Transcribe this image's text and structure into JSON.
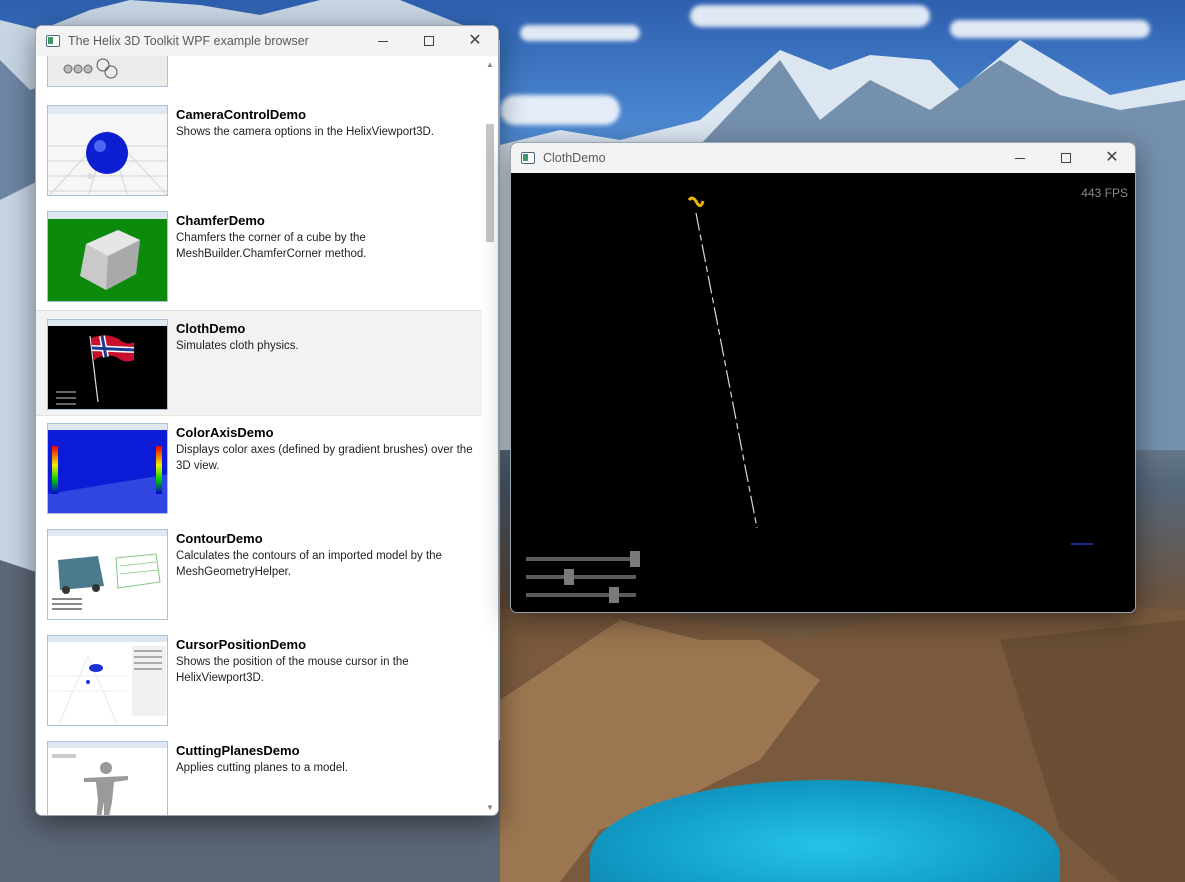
{
  "browser_window": {
    "title": "The Helix 3D Toolkit WPF example browser",
    "items": [
      {
        "name": "CameraControlDemo",
        "description": "Shows the camera options in the HelixViewport3D."
      },
      {
        "name": "ChamferDemo",
        "description": "Chamfers the corner of a cube by the MeshBuilder.ChamferCorner method."
      },
      {
        "name": "ClothDemo",
        "description": "Simulates cloth physics."
      },
      {
        "name": "ColorAxisDemo",
        "description": "Displays color axes (defined by gradient brushes) over the 3D view."
      },
      {
        "name": "ContourDemo",
        "description": "Calculates the contours of an imported model by the MeshGeometryHelper."
      },
      {
        "name": "CursorPositionDemo",
        "description": "Shows the position of the mouse cursor in the HelixViewport3D."
      },
      {
        "name": "CuttingPlanesDemo",
        "description": "Applies cutting planes to a model."
      }
    ],
    "selected_item": "ClothDemo"
  },
  "cloth_window": {
    "title": "ClothDemo",
    "fps_text": "443 FPS",
    "sliders": [
      {
        "name": "slider-1",
        "value": 0.95
      },
      {
        "name": "slider-2",
        "value": 0.4
      },
      {
        "name": "slider-3",
        "value": 0.8
      }
    ]
  },
  "icons": [
    "app-icon",
    "minimize-icon",
    "maximize-icon",
    "close-icon",
    "scroll-up-icon",
    "scroll-down-icon"
  ]
}
